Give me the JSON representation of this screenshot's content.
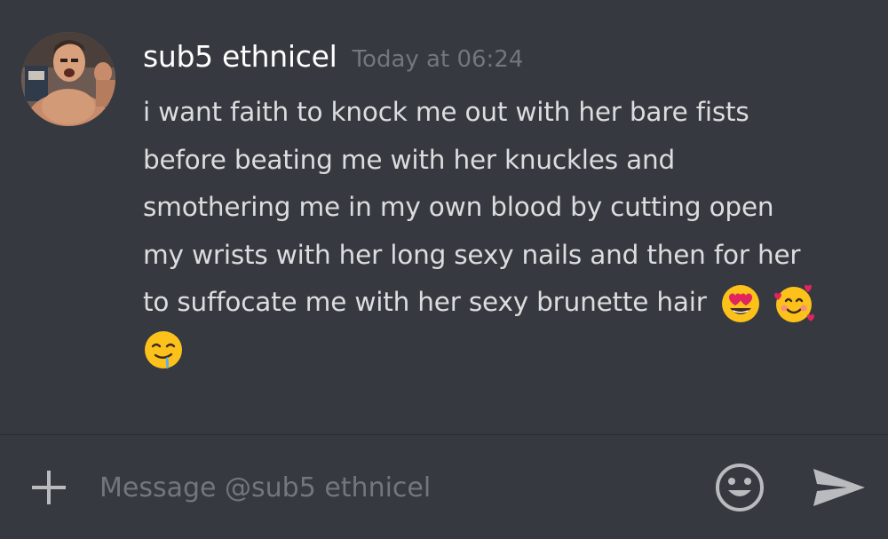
{
  "message": {
    "author": "sub5 ethnicel",
    "timestamp": "Today at 06:24",
    "text_line1": "i want faith to knock me out with her bare fists",
    "text_line2": "before beating me with her knuckles and",
    "text_line3": "smothering me in my own blood by cutting open",
    "text_line4": "my wrists with her long sexy nails and then for her",
    "text_line5": "to suffocate me with her sexy brunette hair",
    "emojis": [
      "heart-eyes-emoji",
      "smiling-face-with-hearts-emoji",
      "drooling-face-emoji"
    ]
  },
  "composer": {
    "placeholder": "Message @sub5 ethnicel",
    "icons": [
      "plus-icon",
      "emoji-icon",
      "send-icon"
    ]
  },
  "colors": {
    "background": "#36393f",
    "username": "#ffffff",
    "message_text": "#dcddde",
    "muted": "#72767d",
    "emoji_yellow": "#fcc21b",
    "heart_red": "#e0245e"
  }
}
